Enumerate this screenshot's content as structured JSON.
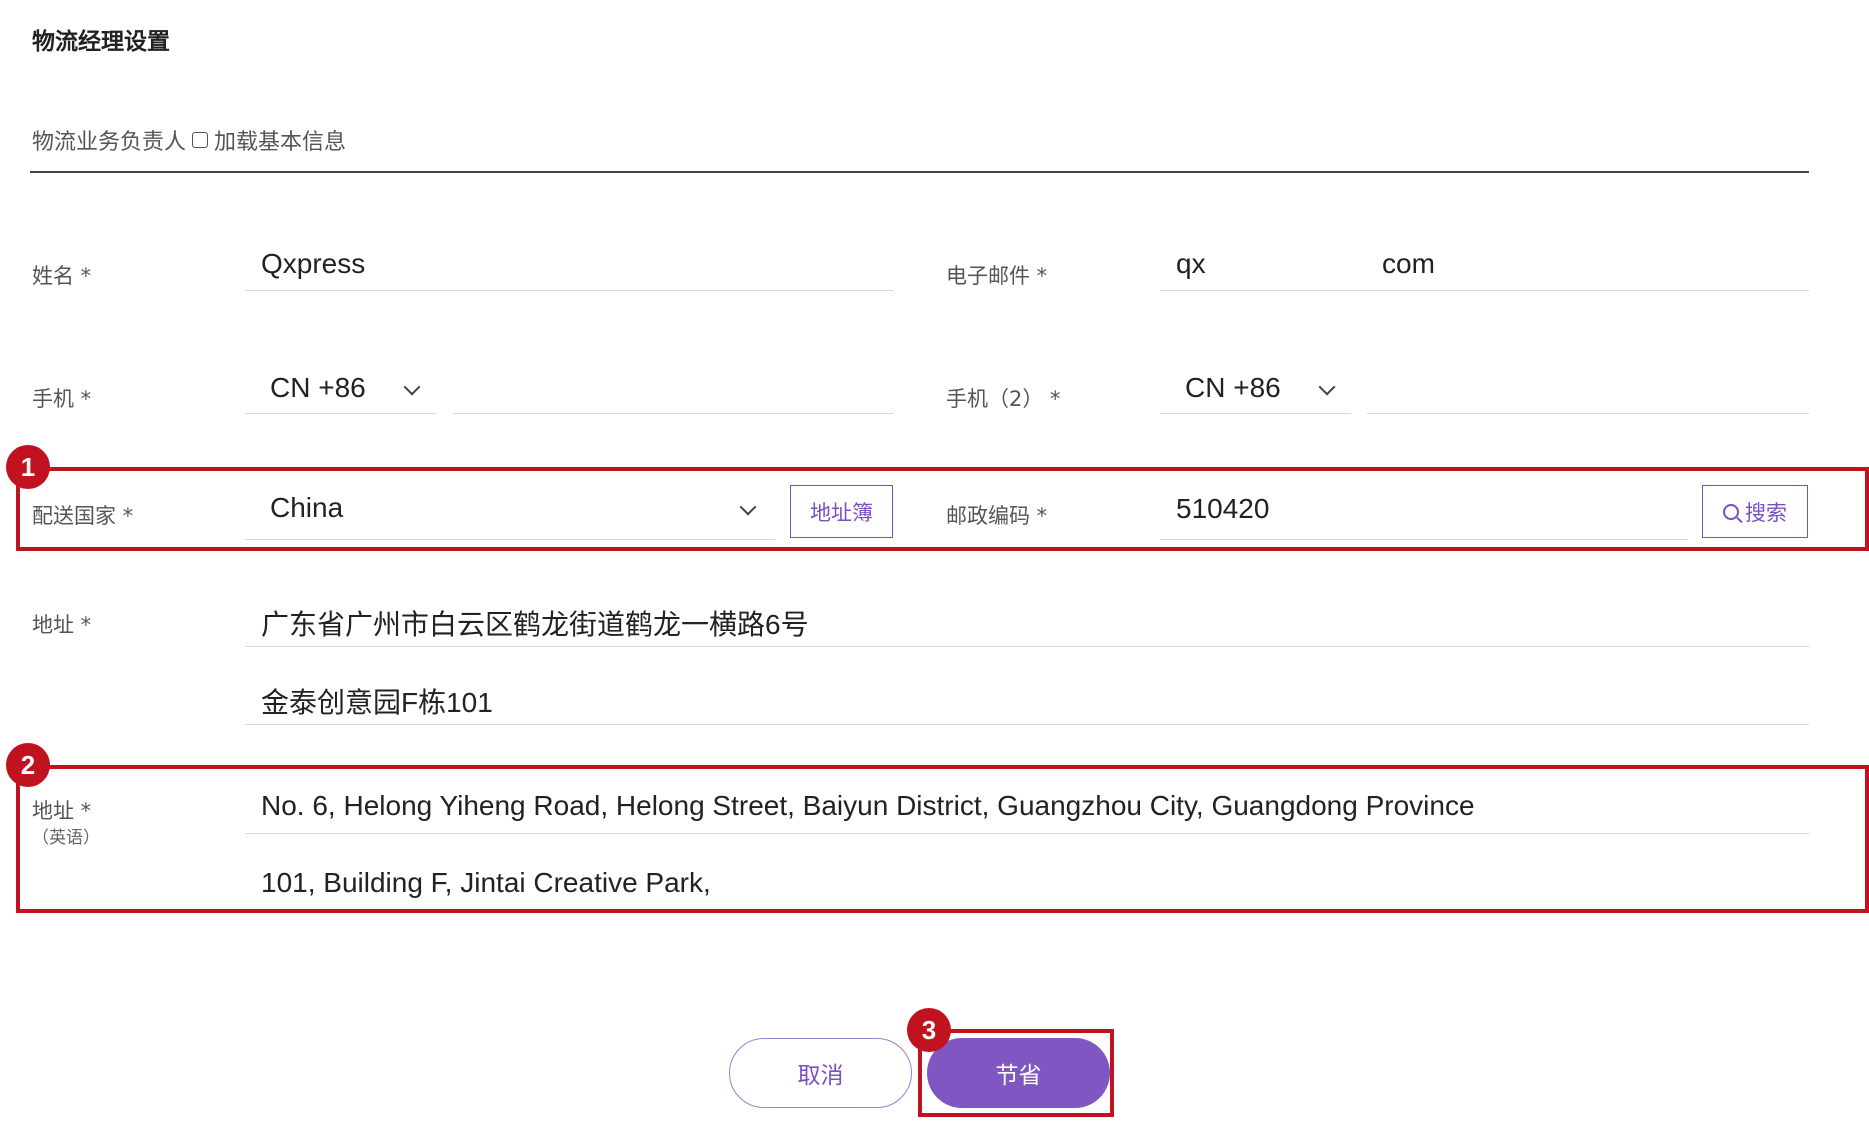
{
  "page_title": "物流经理设置",
  "section": {
    "label": "物流业务负责人",
    "load_basic_info": "加载基本信息"
  },
  "fields": {
    "name": {
      "label": "姓名 *",
      "value": "Qxpress"
    },
    "email": {
      "label": "电子邮件 *",
      "local": "qx",
      "domain": "com"
    },
    "mobile": {
      "label": "手机 *",
      "country_code": "CN +86",
      "number": ""
    },
    "mobile2": {
      "label": "手机（2） *",
      "country_code": "CN +86",
      "number": ""
    },
    "country": {
      "label": "配送国家 *",
      "value": "China",
      "address_book_button": "地址簿"
    },
    "postal_code": {
      "label": "邮政编码 *",
      "value": "510420",
      "search_button": "搜索"
    },
    "address": {
      "label": "地址 *",
      "line1": "广东省广州市白云区鹤龙街道鹤龙一横路6号",
      "line2": "金泰创意园F栋101"
    },
    "address_en": {
      "label": "地址 *",
      "sub_label": "（英语）",
      "line1": "No. 6, Helong Yiheng Road, Helong Street, Baiyun District, Guangzhou City, Guangdong Province",
      "line2": "101, Building F, Jintai Creative Park,"
    }
  },
  "actions": {
    "cancel": "取消",
    "save": "节省"
  },
  "annotations": {
    "badge1": "1",
    "badge2": "2",
    "badge3": "3"
  },
  "colors": {
    "accent": "#7f56c2",
    "highlight": "#c1121f"
  }
}
